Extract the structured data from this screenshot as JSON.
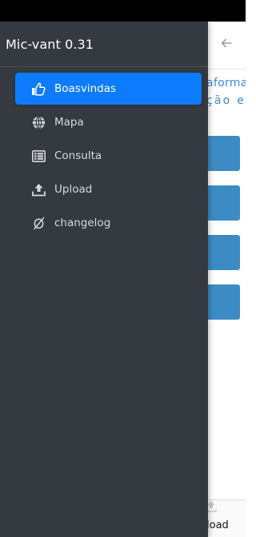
{
  "drawer": {
    "title": "Mic-vant 0.31",
    "items": [
      {
        "label": "Boasvindas",
        "icon": "thumbs-up-icon",
        "active": true
      },
      {
        "label": "Mapa",
        "icon": "globe-icon",
        "active": false
      },
      {
        "label": "Consulta",
        "icon": "list-table-icon",
        "active": false
      },
      {
        "label": "Upload",
        "icon": "upload-icon",
        "active": false
      },
      {
        "label": "changelog",
        "icon": "empty-set-icon",
        "active": false
      }
    ]
  },
  "background": {
    "back_icon": "arrow-left-icon",
    "text_line_1": "aforma",
    "text_line_2": "ção e",
    "bottom_label": "load"
  },
  "colors": {
    "drawer_bg": "#343a40",
    "active_item": "#0d7bfd",
    "card_blue": "#3d8bc4",
    "link_blue": "#3a8ad0"
  }
}
